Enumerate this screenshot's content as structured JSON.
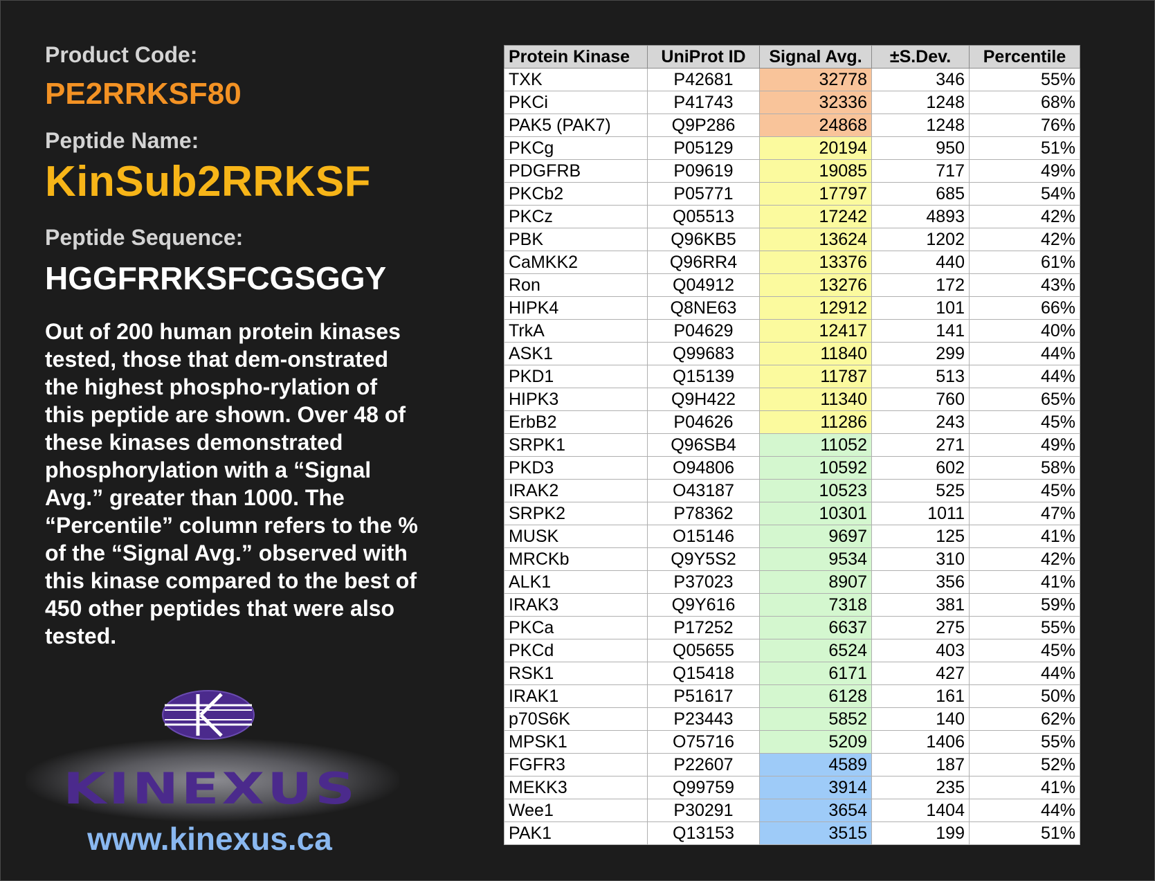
{
  "product": {
    "code_label": "Product Code:",
    "code": "PE2RRKSF80",
    "name_label": "Peptide Name:",
    "name": "KinSub2RRKSF",
    "sequence_label": "Peptide Sequence:",
    "sequence": "HGGFRRKSFCGSGGY",
    "description": "Out of 200 human protein kinases tested, those that dem-onstrated the highest phospho-rylation of this peptide are shown. Over 48 of these kinases demonstrated phosphorylation with a “Signal Avg.” greater than 1000. The “Percentile” column refers to the % of the “Signal Avg.” observed with this kinase compared to the best of 450 other peptides that were also tested."
  },
  "logo": {
    "wordmark": "KINEXUS",
    "url": "www.kinexus.ca"
  },
  "colors": {
    "orange_tier": "#f9c49a",
    "yellow_tier": "#fbfa9e",
    "green_tier": "#d4f7cf",
    "blue_tier": "#9ecbf8"
  },
  "table": {
    "headers": [
      "Protein Kinase",
      "UniProt ID",
      "Signal Avg.",
      "±S.Dev.",
      "Percentile"
    ],
    "rows": [
      {
        "kinase": "TXK",
        "uniprot": "P42681",
        "signal": "32778",
        "sdev": "346",
        "percentile": "55%",
        "tier": "orange"
      },
      {
        "kinase": "PKCi",
        "uniprot": "P41743",
        "signal": "32336",
        "sdev": "1248",
        "percentile": "68%",
        "tier": "orange"
      },
      {
        "kinase": "PAK5 (PAK7)",
        "uniprot": "Q9P286",
        "signal": "24868",
        "sdev": "1248",
        "percentile": "76%",
        "tier": "orange"
      },
      {
        "kinase": "PKCg",
        "uniprot": "P05129",
        "signal": "20194",
        "sdev": "950",
        "percentile": "51%",
        "tier": "yellow"
      },
      {
        "kinase": "PDGFRB",
        "uniprot": "P09619",
        "signal": "19085",
        "sdev": "717",
        "percentile": "49%",
        "tier": "yellow"
      },
      {
        "kinase": "PKCb2",
        "uniprot": "P05771",
        "signal": "17797",
        "sdev": "685",
        "percentile": "54%",
        "tier": "yellow"
      },
      {
        "kinase": "PKCz",
        "uniprot": "Q05513",
        "signal": "17242",
        "sdev": "4893",
        "percentile": "42%",
        "tier": "yellow"
      },
      {
        "kinase": "PBK",
        "uniprot": "Q96KB5",
        "signal": "13624",
        "sdev": "1202",
        "percentile": "42%",
        "tier": "yellow"
      },
      {
        "kinase": "CaMKK2",
        "uniprot": "Q96RR4",
        "signal": "13376",
        "sdev": "440",
        "percentile": "61%",
        "tier": "yellow"
      },
      {
        "kinase": "Ron",
        "uniprot": "Q04912",
        "signal": "13276",
        "sdev": "172",
        "percentile": "43%",
        "tier": "yellow"
      },
      {
        "kinase": "HIPK4",
        "uniprot": "Q8NE63",
        "signal": "12912",
        "sdev": "101",
        "percentile": "66%",
        "tier": "yellow"
      },
      {
        "kinase": "TrkA",
        "uniprot": "P04629",
        "signal": "12417",
        "sdev": "141",
        "percentile": "40%",
        "tier": "yellow"
      },
      {
        "kinase": "ASK1",
        "uniprot": "Q99683",
        "signal": "11840",
        "sdev": "299",
        "percentile": "44%",
        "tier": "yellow"
      },
      {
        "kinase": "PKD1",
        "uniprot": "Q15139",
        "signal": "11787",
        "sdev": "513",
        "percentile": "44%",
        "tier": "yellow"
      },
      {
        "kinase": "HIPK3",
        "uniprot": "Q9H422",
        "signal": "11340",
        "sdev": "760",
        "percentile": "65%",
        "tier": "yellow"
      },
      {
        "kinase": "ErbB2",
        "uniprot": "P04626",
        "signal": "11286",
        "sdev": "243",
        "percentile": "45%",
        "tier": "yellow"
      },
      {
        "kinase": "SRPK1",
        "uniprot": "Q96SB4",
        "signal": "11052",
        "sdev": "271",
        "percentile": "49%",
        "tier": "green"
      },
      {
        "kinase": "PKD3",
        "uniprot": "O94806",
        "signal": "10592",
        "sdev": "602",
        "percentile": "58%",
        "tier": "green"
      },
      {
        "kinase": "IRAK2",
        "uniprot": "O43187",
        "signal": "10523",
        "sdev": "525",
        "percentile": "45%",
        "tier": "green"
      },
      {
        "kinase": "SRPK2",
        "uniprot": "P78362",
        "signal": "10301",
        "sdev": "1011",
        "percentile": "47%",
        "tier": "green"
      },
      {
        "kinase": "MUSK",
        "uniprot": "O15146",
        "signal": "9697",
        "sdev": "125",
        "percentile": "41%",
        "tier": "green"
      },
      {
        "kinase": "MRCKb",
        "uniprot": "Q9Y5S2",
        "signal": "9534",
        "sdev": "310",
        "percentile": "42%",
        "tier": "green"
      },
      {
        "kinase": "ALK1",
        "uniprot": "P37023",
        "signal": "8907",
        "sdev": "356",
        "percentile": "41%",
        "tier": "green"
      },
      {
        "kinase": "IRAK3",
        "uniprot": "Q9Y616",
        "signal": "7318",
        "sdev": "381",
        "percentile": "59%",
        "tier": "green"
      },
      {
        "kinase": "PKCa",
        "uniprot": "P17252",
        "signal": "6637",
        "sdev": "275",
        "percentile": "55%",
        "tier": "green"
      },
      {
        "kinase": "PKCd",
        "uniprot": "Q05655",
        "signal": "6524",
        "sdev": "403",
        "percentile": "45%",
        "tier": "green"
      },
      {
        "kinase": "RSK1",
        "uniprot": "Q15418",
        "signal": "6171",
        "sdev": "427",
        "percentile": "44%",
        "tier": "green"
      },
      {
        "kinase": "IRAK1",
        "uniprot": "P51617",
        "signal": "6128",
        "sdev": "161",
        "percentile": "50%",
        "tier": "green"
      },
      {
        "kinase": "p70S6K",
        "uniprot": "P23443",
        "signal": "5852",
        "sdev": "140",
        "percentile": "62%",
        "tier": "green"
      },
      {
        "kinase": "MPSK1",
        "uniprot": "O75716",
        "signal": "5209",
        "sdev": "1406",
        "percentile": "55%",
        "tier": "green"
      },
      {
        "kinase": "FGFR3",
        "uniprot": "P22607",
        "signal": "4589",
        "sdev": "187",
        "percentile": "52%",
        "tier": "blue"
      },
      {
        "kinase": "MEKK3",
        "uniprot": "Q99759",
        "signal": "3914",
        "sdev": "235",
        "percentile": "41%",
        "tier": "blue"
      },
      {
        "kinase": "Wee1",
        "uniprot": "P30291",
        "signal": "3654",
        "sdev": "1404",
        "percentile": "44%",
        "tier": "blue"
      },
      {
        "kinase": "PAK1",
        "uniprot": "Q13153",
        "signal": "3515",
        "sdev": "199",
        "percentile": "51%",
        "tier": "blue"
      }
    ]
  }
}
